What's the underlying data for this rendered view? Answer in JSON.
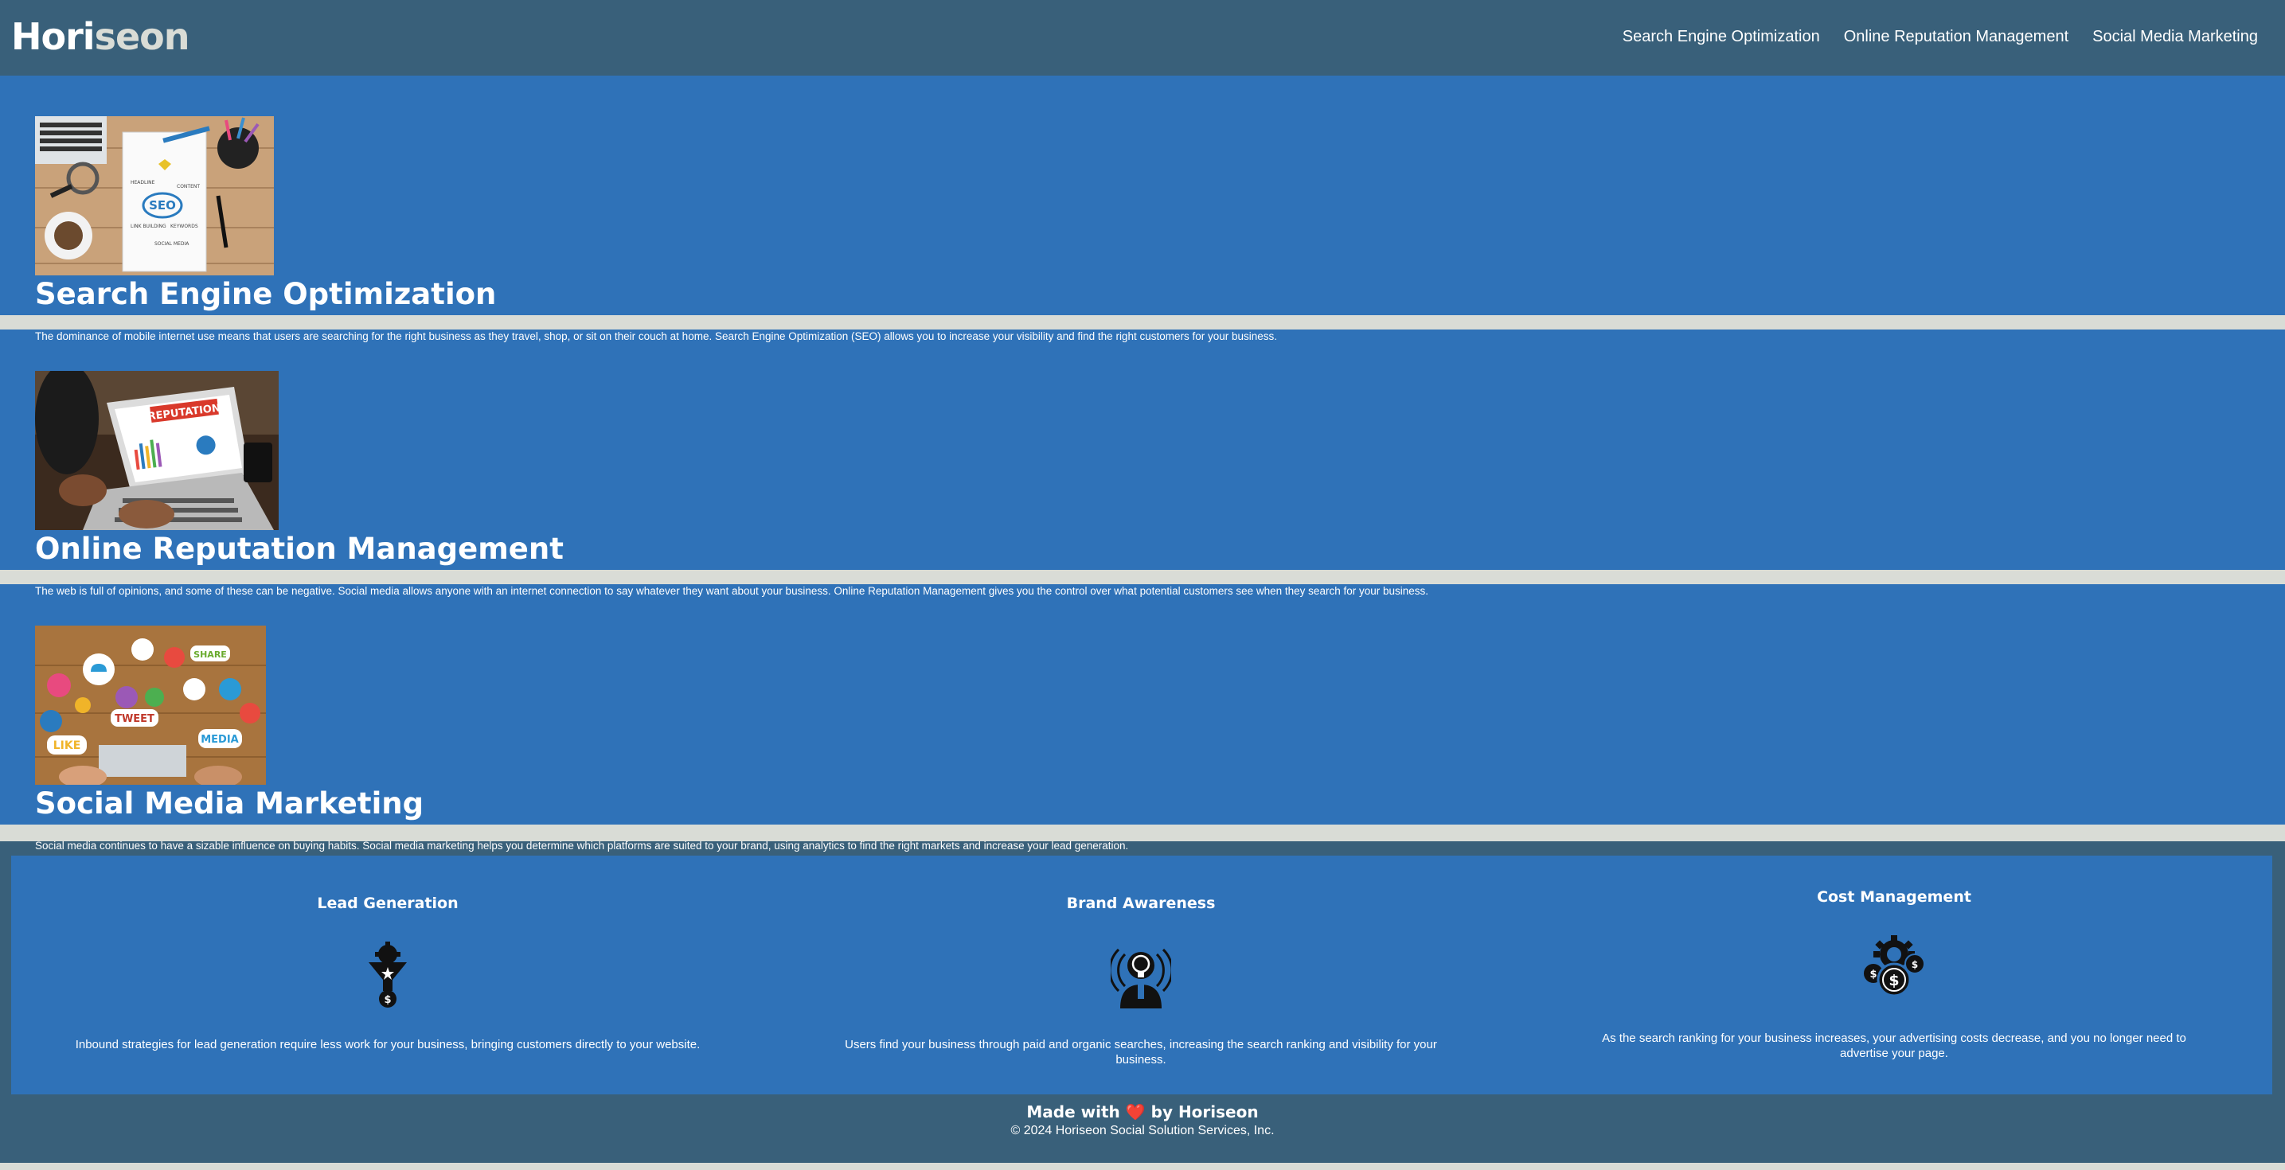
{
  "header": {
    "logo_main": "Hori",
    "logo_accent": "seon",
    "nav": [
      {
        "label": "Search Engine Optimization"
      },
      {
        "label": "Online Reputation Management"
      },
      {
        "label": "Social Media Marketing"
      }
    ]
  },
  "services": [
    {
      "title": "Search Engine Optimization",
      "image_alt": "SEO",
      "text": "The dominance of mobile internet use means that users are searching for the right business as they travel, shop, or sit on their couch at home. Search Engine Optimization (SEO) allows you to increase your visibility and find the right customers for your business."
    },
    {
      "title": "Online Reputation Management",
      "image_alt": "REPUTATION",
      "text": "The web is full of opinions, and some of these can be negative. Social media allows anyone with an internet connection to say whatever they want about your business. Online Reputation Management gives you the control over what potential customers see when they search for your business."
    },
    {
      "title": "Social Media Marketing",
      "image_alt": "SHARE TWEET LIKE MEDIA",
      "text": "Social media continues to have a sizable influence on buying habits. Social media marketing helps you determine which platforms are suited to your brand, using analytics to find the right markets and increase your lead generation."
    }
  ],
  "benefits": [
    {
      "title": "Lead Generation",
      "icon": "funnel-gear-dollar-icon",
      "text": "Inbound strategies for lead generation require less work for your business, bringing customers directly to your website."
    },
    {
      "title": "Brand Awareness",
      "icon": "lightbulb-head-icon",
      "text": "Users find your business through paid and organic searches, increasing the search ranking and visibility for your business."
    },
    {
      "title": "Cost Management",
      "icon": "gear-coins-icon",
      "text": "As the search ranking for your business increases, your advertising costs decrease, and you no longer need to advertise your page."
    }
  ],
  "footer": {
    "made_prefix": "Made with",
    "heart": "❤️",
    "made_suffix": "by Horiseon",
    "copyright": "© 2024 Horiseon Social Solution Services, Inc."
  },
  "colors": {
    "header_bg": "#39607a",
    "section_bg": "#2f72b8",
    "page_bg": "#d9dcd6",
    "text": "#ffffff"
  }
}
